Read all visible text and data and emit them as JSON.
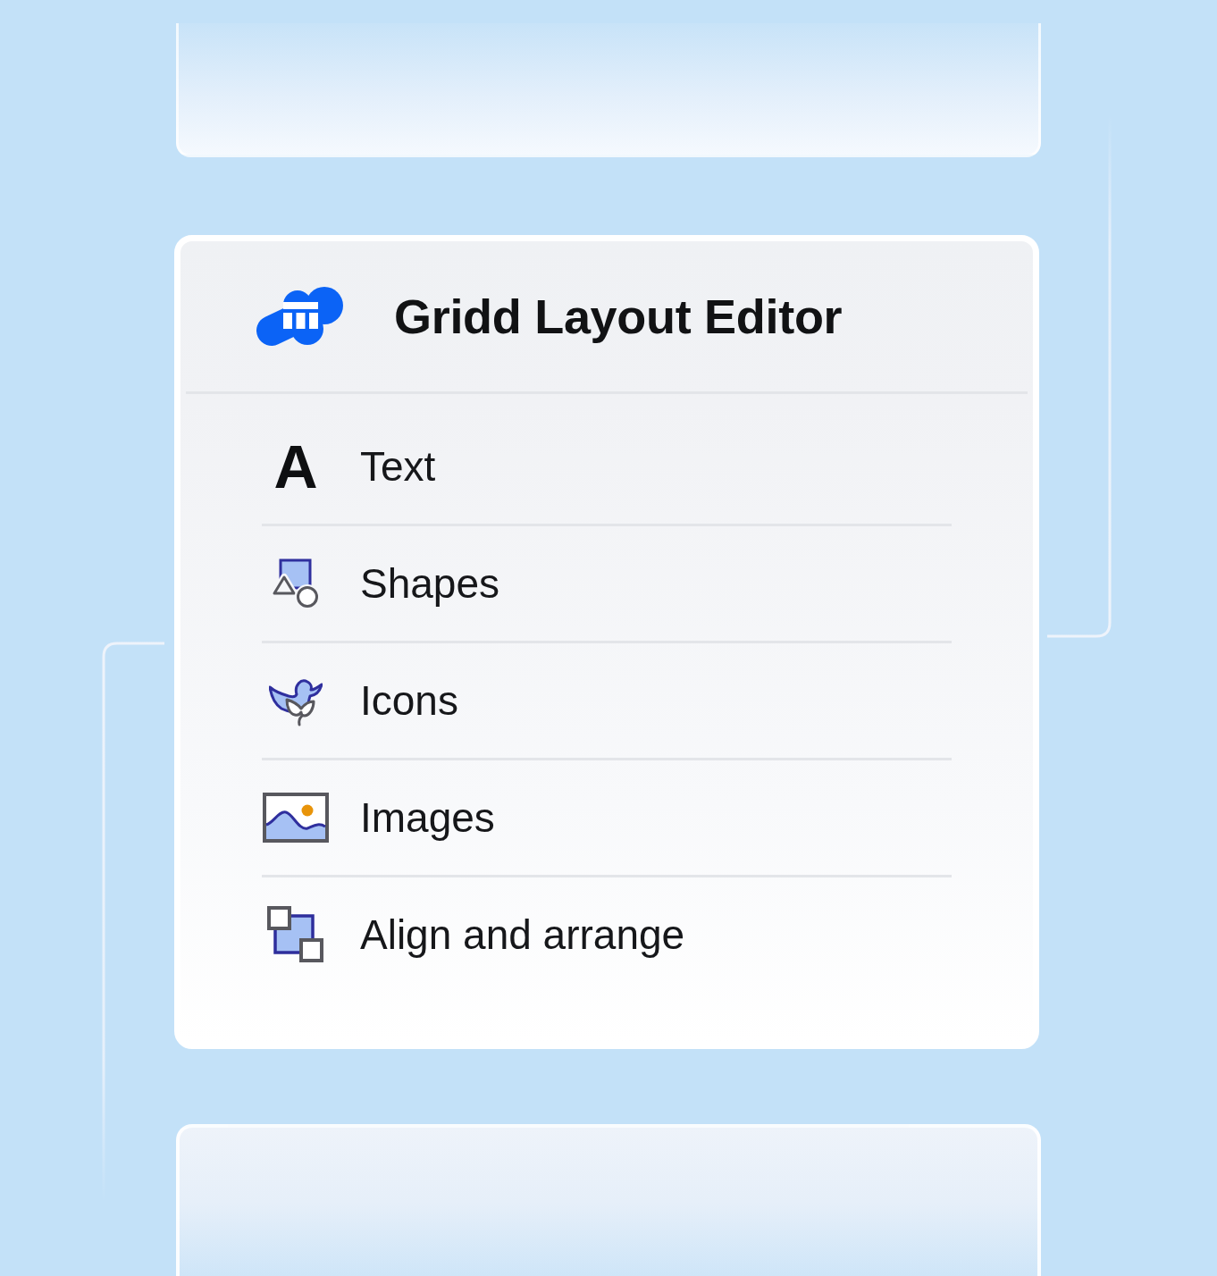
{
  "app": {
    "title": "Gridd Layout Editor"
  },
  "menu": {
    "items": [
      {
        "kind": "text",
        "glyph": "A",
        "label": "Text"
      },
      {
        "kind": "shapes",
        "label": "Shapes"
      },
      {
        "kind": "icons",
        "label": "Icons"
      },
      {
        "kind": "images",
        "label": "Images"
      },
      {
        "kind": "align",
        "label": "Align and arrange"
      }
    ]
  }
}
